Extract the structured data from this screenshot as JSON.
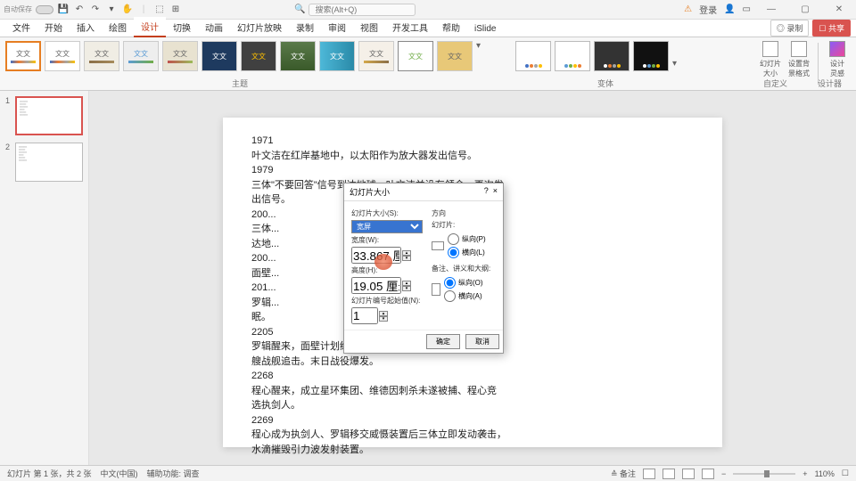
{
  "titlebar": {
    "app": "自动保存",
    "search_ph": "搜索(Alt+Q)",
    "user": "登录"
  },
  "tabs": {
    "items": [
      "文件",
      "开始",
      "插入",
      "绘图",
      "设计",
      "切换",
      "动画",
      "幻灯片放映",
      "录制",
      "审阅",
      "视图",
      "开发工具",
      "帮助",
      "iSlide"
    ],
    "active": 4,
    "record": "◎ 录制",
    "share": "☐ 共享"
  },
  "ribbon": {
    "themeText": "文文",
    "groupTheme": "主题",
    "groupVariant": "变体",
    "groupCustom": "自定义",
    "groupDesign": "设计器",
    "btnSize": "幻灯片\n大小",
    "btnBg": "设置背\n景格式",
    "btnDesign": "设计\n灵感"
  },
  "thumbs": {
    "n1": "1",
    "n2": "2"
  },
  "slide": {
    "lines": [
      "1971",
      "叶文洁在红岸基地中，以太阳作为放大器发出信号。",
      "1979",
      "三体\"不要回答\"信号到达地球，叶文洁并没有领会，再次发",
      "出信号。",
      "200...",
      "三体...                                        制成的智子，4年后到",
      "达地...",
      "200...",
      "面壁...                                        起强冬眠。",
      "201...",
      "罗辑...                                   J3X1的咒语，随后冬",
      "眠。",
      "2205",
      "罗辑醒来，面壁计划结束。章北海率自然选择号逃亡，四",
      "艘战舰追击。末日战役爆发。",
      "2268",
      "程心醒来，成立星环集团、维德因刺杀未遂被捕、程心竞",
      "选执剑人。",
      "2269",
      "程心成为执剑人、罗辑移交威慑装置后三体立即发动袭击，",
      "水滴摧毁引力波发射装置。"
    ]
  },
  "dialog": {
    "title": "幻灯片大小",
    "help": "?",
    "close": "×",
    "sizeFor": "幻灯片大小(S):",
    "sizeVal": "宽屏",
    "widthL": "宽度(W):",
    "widthV": "33.867 厘米",
    "heightL": "高度(H):",
    "heightV": "19.05 厘米",
    "numL": "幻灯片编号起始值(N):",
    "numV": "1",
    "orient": "方向",
    "slides": "幻灯片:",
    "portrait": "纵向(P)",
    "landscape": "横向(L)",
    "notes": "备注、讲义和大纲:",
    "portraitO": "纵向(O)",
    "landscapeA": "横向(A)",
    "ok": "确定",
    "cancel": "取消"
  },
  "status": {
    "slide": "幻灯片 第 1 张，共 2 张",
    "lang": "中文(中国)",
    "acc": "辅助功能: 调查",
    "notes": "≙ 备注",
    "zoom": "110%",
    "fit": "☐"
  }
}
